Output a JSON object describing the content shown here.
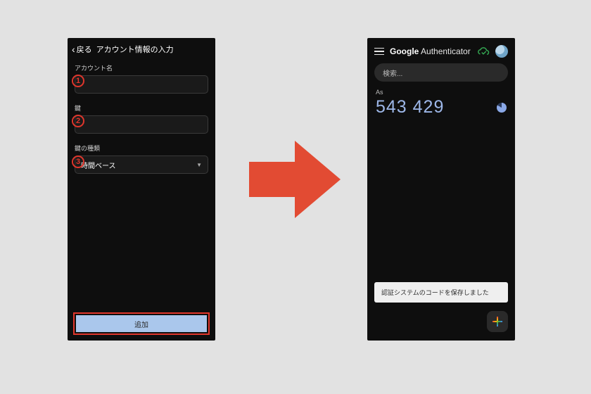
{
  "left": {
    "back_label": "戻る",
    "title": "アカウント情報の入力",
    "fields": {
      "account_label": "アカウント名",
      "account_value": "",
      "key_label": "鍵",
      "key_value": "",
      "type_label": "鍵の種類",
      "type_value": "時間ベース"
    },
    "markers": {
      "m1": "1",
      "m2": "2",
      "m3": "3"
    },
    "add_label": "追加"
  },
  "right": {
    "brand_bold": "Google",
    "brand_light": " Authenticator",
    "search_placeholder": "検索...",
    "account_name": "As",
    "code": "543 429",
    "toast": "認証システムのコードを保存しました"
  }
}
